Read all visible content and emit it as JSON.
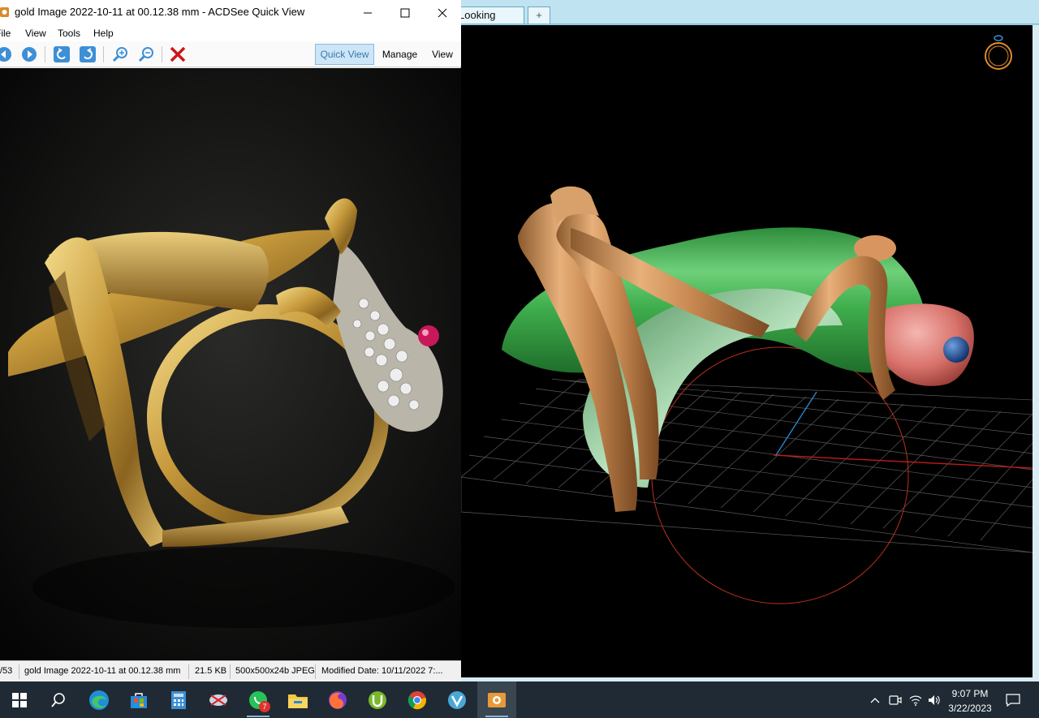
{
  "acdsee": {
    "title": "gold Image 2022-10-11 at 00.12.38 mm - ACDSee Quick View",
    "menu": {
      "file": "File",
      "view": "View",
      "tools": "Tools",
      "help": "Help"
    },
    "modes": {
      "quick_view": "Quick View",
      "manage": "Manage",
      "view": "View"
    },
    "status": {
      "position": "/53",
      "filename": "gold Image 2022-10-11 at 00.12.38 mm",
      "size": "21.5 KB",
      "dimensions": "500x500x24b JPEG",
      "modified": "Modified Date: 10/11/2022 7:..."
    }
  },
  "app3d": {
    "tabs": {
      "current": "Looking Down",
      "add": "+"
    }
  },
  "taskbar": {
    "whatsapp_badge": "7",
    "clock_time": "9:07 PM",
    "clock_date": "3/22/2023"
  }
}
